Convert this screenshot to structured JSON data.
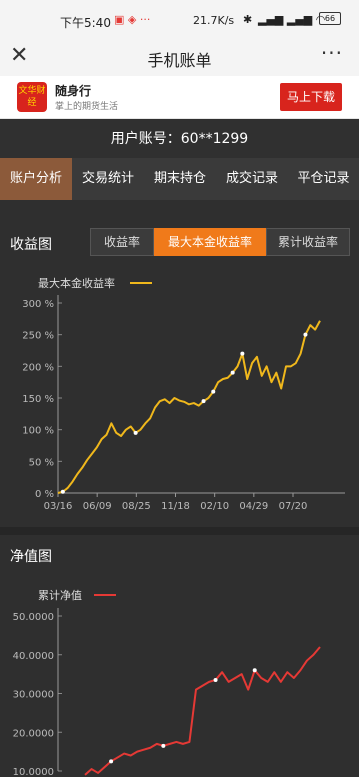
{
  "status": {
    "time": "下午5:40",
    "speed": "21.7K/s",
    "battery": "66"
  },
  "titlebar": {
    "title": "手机账单",
    "close_icon": "close-icon",
    "more_icon": "more-icon"
  },
  "banner": {
    "logo_text": "文华财经",
    "app_name": "随身行",
    "slogan": "掌上的期货生活",
    "download": "马上下载"
  },
  "account": {
    "label": "用户账号：60**1299"
  },
  "tabs": [
    {
      "label": "账户分析",
      "active": true
    },
    {
      "label": "交易统计",
      "active": false
    },
    {
      "label": "期末持仓",
      "active": false
    },
    {
      "label": "成交记录",
      "active": false
    },
    {
      "label": "平仓记录",
      "active": false
    }
  ],
  "profit_section": {
    "title": "收益图",
    "segments": [
      {
        "label": "收益率",
        "active": false
      },
      {
        "label": "最大本金收益率",
        "active": true
      },
      {
        "label": "累计收益率",
        "active": false
      }
    ]
  },
  "nav_section": {
    "title": "净值图"
  },
  "colors": {
    "profit_line": "#f0b81c",
    "nav_line": "#e53935",
    "active_tab": "#8c5a3a",
    "active_segment": "#f07a1a"
  },
  "chart_data": [
    {
      "type": "line",
      "legend": "最大本金收益率",
      "yticks": [
        "0 %",
        "50 %",
        "100 %",
        "150 %",
        "200 %",
        "250 %",
        "300 %"
      ],
      "ylim": [
        0,
        300
      ],
      "xticks": [
        "03/16",
        "06/09",
        "08/25",
        "11/18",
        "02/10",
        "04/29",
        "07/20"
      ],
      "series": [
        {
          "values": [
            0,
            2,
            8,
            18,
            30,
            40,
            52,
            62,
            72,
            85,
            92,
            110,
            95,
            90,
            100,
            105,
            95,
            100,
            110,
            118,
            135,
            145,
            148,
            142,
            150,
            146,
            144,
            140,
            142,
            138,
            145,
            150,
            160,
            175,
            180,
            182,
            190,
            200,
            220,
            180,
            205,
            215,
            185,
            200,
            175,
            190,
            165,
            200,
            200,
            205,
            220,
            250,
            265,
            258,
            272
          ]
        }
      ],
      "markers": [
        0,
        45,
        95,
        140,
        150,
        180,
        220,
        265
      ]
    },
    {
      "type": "line",
      "legend": "累计净值",
      "yticks": [
        "10.0000",
        "20.0000",
        "30.0000",
        "40.0000",
        "50.0000"
      ],
      "ylim": [
        10,
        50
      ],
      "series": [
        {
          "values": [
            9.0,
            10.5,
            9.5,
            11.0,
            12.5,
            13.5,
            14.5,
            14.0,
            15.0,
            15.5,
            16.0,
            17.0,
            16.5,
            17.0,
            17.5,
            17.0,
            17.5,
            31.0,
            32.0,
            33.0,
            33.5,
            35.5,
            33.0,
            34.0,
            35.0,
            31.0,
            36.0,
            34.0,
            33.0,
            35.5,
            33.0,
            35.5,
            34.0,
            36.0,
            38.5,
            40.0,
            42.0
          ]
        }
      ]
    }
  ]
}
